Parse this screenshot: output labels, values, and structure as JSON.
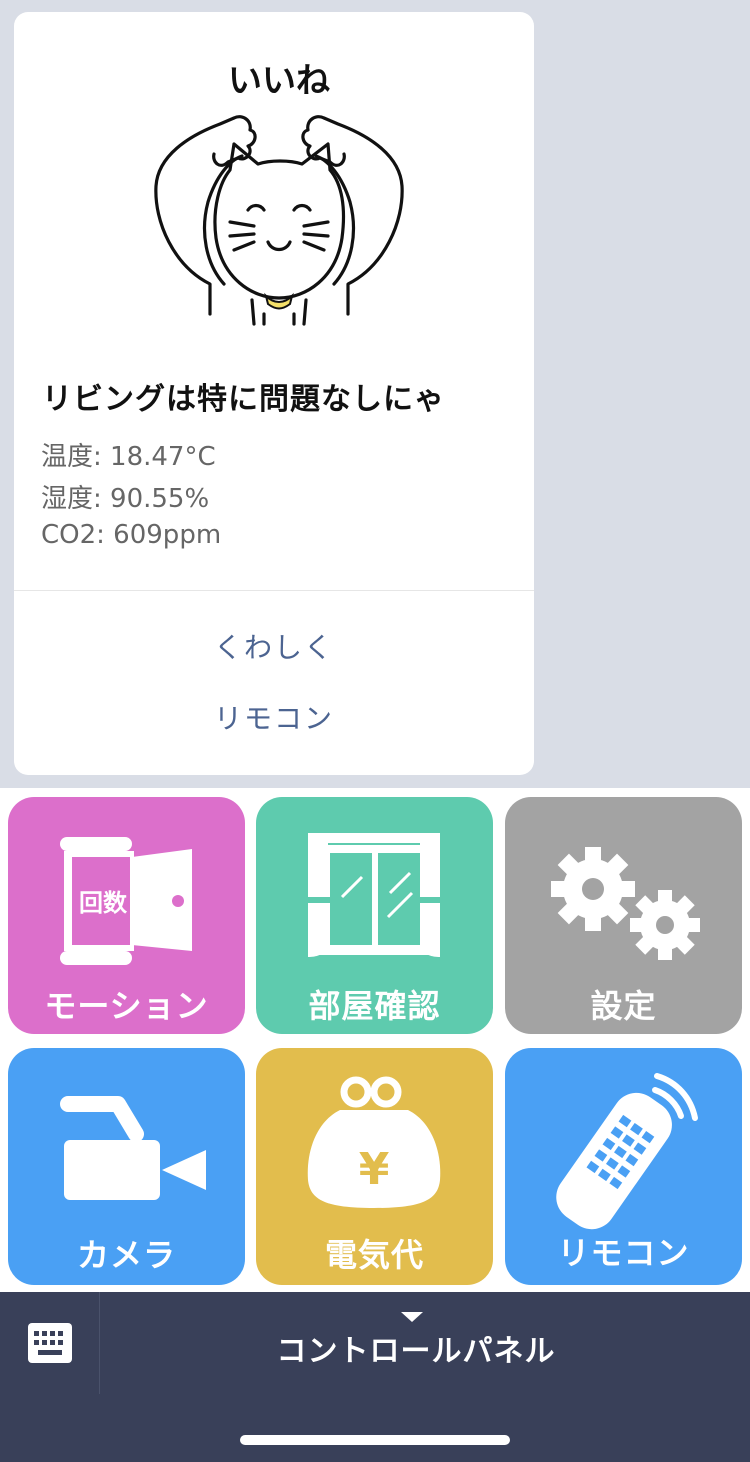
{
  "chat": {
    "sticker_text": "いいね",
    "card": {
      "title": "リビングは特に問題なしにゃ",
      "lines": [
        "温度: 18.47°C",
        "湿度: 90.55%",
        "CO2: 609ppm"
      ],
      "actions": [
        "くわしく",
        "リモコン"
      ]
    }
  },
  "menu": {
    "tiles": [
      {
        "label": "モーション",
        "color": "#dc6fcb",
        "icon": "door-icon",
        "badge": "回数"
      },
      {
        "label": "部屋確認",
        "color": "#5ecbae",
        "icon": "window-icon"
      },
      {
        "label": "設定",
        "color": "#a3a3a3",
        "icon": "gear-icon"
      },
      {
        "label": "カメラ",
        "color": "#4aa0f4",
        "icon": "camera-icon"
      },
      {
        "label": "電気代",
        "color": "#e2bd4d",
        "icon": "purse-icon",
        "badge": "¥"
      },
      {
        "label": "リモコン",
        "color": "#4aa0f4",
        "icon": "remote-icon"
      }
    ]
  },
  "bottom_bar": {
    "panel_label": "コントロールパネル",
    "keyboard_icon": "keyboard-icon",
    "background": "#394059"
  }
}
